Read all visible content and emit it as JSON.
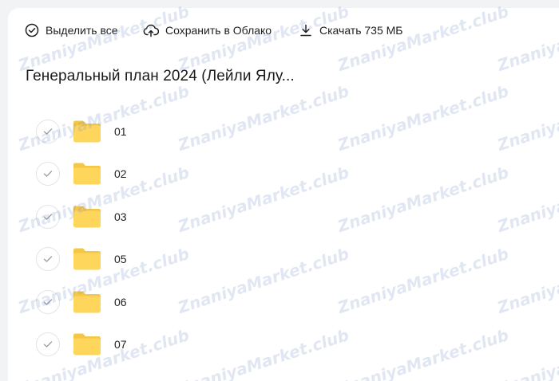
{
  "toolbar": {
    "select_all": "Выделить все",
    "save_to_cloud": "Сохранить в Облако",
    "download": "Скачать 735 МБ"
  },
  "folder": {
    "title": "Генеральный план 2024 (Лейли Ялу..."
  },
  "items": [
    {
      "name": "01"
    },
    {
      "name": "02"
    },
    {
      "name": "03"
    },
    {
      "name": "05"
    },
    {
      "name": "06"
    },
    {
      "name": "07"
    }
  ],
  "icons": {
    "select_all": "check-circle-icon",
    "save_to_cloud": "cloud-upload-icon",
    "download": "download-icon",
    "item": "folder-icon",
    "item_check": "check-icon"
  },
  "colors": {
    "folder": "#ffd65c",
    "folder_tab": "#f6c744",
    "check": "#9aa0a6",
    "border": "#e2e4e8"
  },
  "watermark": "ZnaniyaMarket.club"
}
